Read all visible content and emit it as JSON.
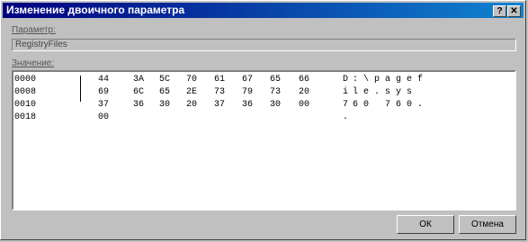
{
  "window": {
    "title": "Изменение двоичного параметра",
    "help_label": "?",
    "close_label": "✕"
  },
  "param": {
    "label": "Параметр:",
    "value": "RegistryFiles"
  },
  "values": {
    "label": "Значение:",
    "rows": [
      {
        "addr": "0000",
        "bytes": [
          "44",
          "3A",
          "5C",
          "70",
          "61",
          "67",
          "65",
          "66"
        ],
        "ascii": [
          "D",
          ":",
          "\\",
          "p",
          "a",
          "g",
          "e",
          "f"
        ]
      },
      {
        "addr": "0008",
        "bytes": [
          "69",
          "6C",
          "65",
          "2E",
          "73",
          "79",
          "73",
          "20"
        ],
        "ascii": [
          "i",
          "l",
          "e",
          ".",
          "s",
          "y",
          "s",
          " "
        ]
      },
      {
        "addr": "0010",
        "bytes": [
          "37",
          "36",
          "30",
          "20",
          "37",
          "36",
          "30",
          "00"
        ],
        "ascii": [
          "7",
          "6",
          "0",
          " ",
          "7",
          "6",
          "0",
          "."
        ]
      },
      {
        "addr": "0018",
        "bytes": [
          "00",
          "",
          "",
          "",
          "",
          "",
          "",
          ""
        ],
        "ascii": [
          ".",
          " ",
          " ",
          " ",
          " ",
          " ",
          " ",
          " "
        ]
      }
    ]
  },
  "buttons": {
    "ok": "ОК",
    "cancel": "Отмена"
  }
}
